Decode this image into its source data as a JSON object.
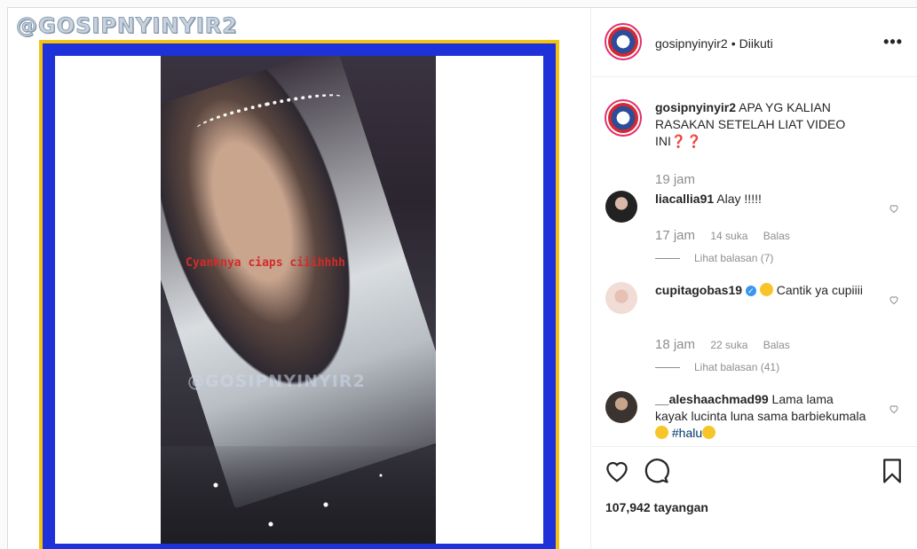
{
  "media": {
    "watermark_top": "@GOSIPNYINYIR2",
    "video_caption": "Cyanknya ciaps ciiihhhh",
    "watermark_mid": "@GOSIPNYINYIR2"
  },
  "header": {
    "username": "gosipnyinyir2",
    "separator": "•",
    "follow_status": "Diikuti",
    "more_icon": "more-icon",
    "more_label": "•••"
  },
  "caption": {
    "username": "gosipnyinyir2",
    "text": "APA YG KALIAN RASAKAN SETELAH LIAT VIDEO INI",
    "emoji": "❓❓",
    "time": "19 jam"
  },
  "comments": [
    {
      "username": "liacallia91",
      "text": "Alay !!!!!",
      "time": "17 jam",
      "likes": "14 suka",
      "reply_label": "Balas",
      "view_replies": "Lihat balasan (7)"
    },
    {
      "username": "cupitagobas19",
      "verified": true,
      "text": "Cantik ya cupiiii",
      "time": "18 jam",
      "likes": "22 suka",
      "reply_label": "Balas",
      "view_replies": "Lihat balasan (41)"
    },
    {
      "username": "__aleshaachmad99",
      "text": "Lama lama kayak lucinta luna sama barbiekumala",
      "hashtag": "#halu"
    }
  ],
  "actions": {
    "like_icon": "heart-icon",
    "comment_icon": "comment-icon",
    "save_icon": "bookmark-icon",
    "views": "107,942 tayangan"
  },
  "colors": {
    "frame_yellow": "#f3c313",
    "frame_blue": "#1f31d8",
    "border": "#dbdbdb",
    "secondary_text": "#8e8e8e"
  }
}
